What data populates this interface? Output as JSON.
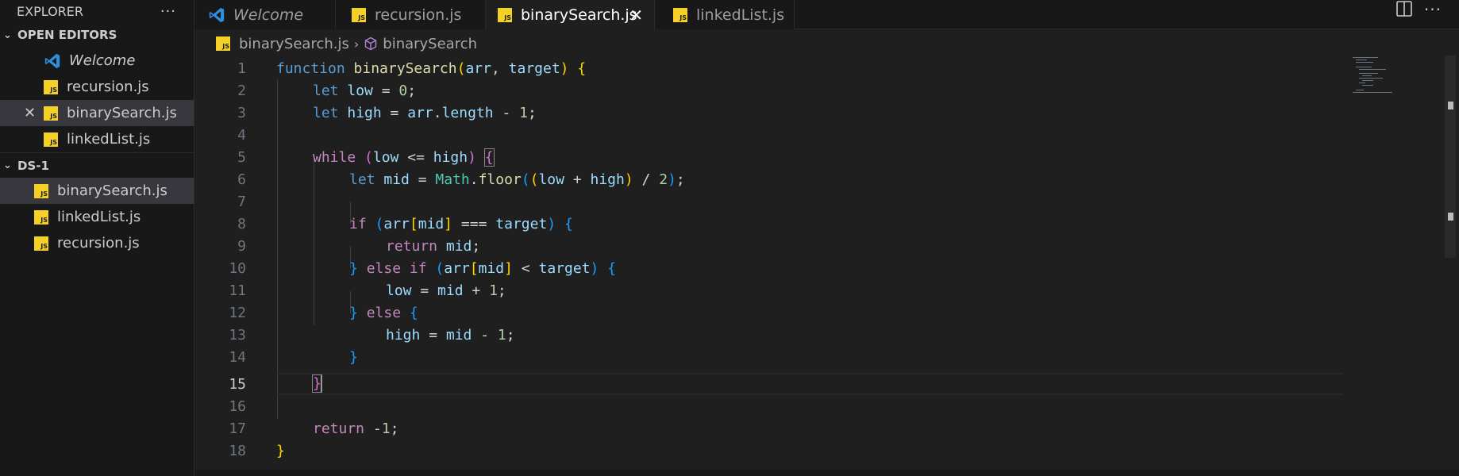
{
  "explorer": {
    "title": "EXPLORER",
    "more": "···",
    "open_editors_label": "OPEN EDITORS",
    "open_editors": [
      {
        "name": "Welcome",
        "type": "vscode"
      },
      {
        "name": "recursion.js",
        "type": "js"
      },
      {
        "name": "binarySearch.js",
        "type": "js",
        "active": true
      },
      {
        "name": "linkedList.js",
        "type": "js"
      }
    ],
    "folder_label": "DS-1",
    "files": [
      {
        "name": "binarySearch.js",
        "active": true
      },
      {
        "name": "linkedList.js"
      },
      {
        "name": "recursion.js"
      }
    ],
    "close_glyph": "✕",
    "chevron": "⌄"
  },
  "tabs": [
    {
      "name": "Welcome",
      "type": "vscode"
    },
    {
      "name": "recursion.js",
      "type": "js"
    },
    {
      "name": "binarySearch.js",
      "type": "js",
      "active": true
    },
    {
      "name": "linkedList.js",
      "type": "js"
    }
  ],
  "tab_close_glyph": "✕",
  "tab_more": "···",
  "js_badge": "JS",
  "breadcrumb": {
    "file": "binarySearch.js",
    "separator": "›",
    "symbol": "binarySearch"
  },
  "editor": {
    "current_line": 15,
    "lines": [
      {
        "n": "1"
      },
      {
        "n": "2"
      },
      {
        "n": "3"
      },
      {
        "n": "4"
      },
      {
        "n": "5"
      },
      {
        "n": "6"
      },
      {
        "n": "7"
      },
      {
        "n": "8"
      },
      {
        "n": "9"
      },
      {
        "n": "10"
      },
      {
        "n": "11"
      },
      {
        "n": "12"
      },
      {
        "n": "13"
      },
      {
        "n": "14"
      },
      {
        "n": "15"
      },
      {
        "n": "16"
      },
      {
        "n": "17"
      },
      {
        "n": "18"
      }
    ],
    "code": {
      "l1": [
        "function",
        "binarySearch",
        "(",
        "arr",
        ", ",
        "target",
        ") ",
        "{"
      ],
      "l2": [
        "let",
        "low",
        " = ",
        "0",
        ";"
      ],
      "l3": [
        "let",
        "high",
        " = ",
        "arr",
        ".",
        "length",
        " - ",
        "1",
        ";"
      ],
      "l5": [
        "while",
        "(",
        "low",
        " <= ",
        "high",
        ") ",
        "{"
      ],
      "l6": [
        "let",
        "mid",
        " = ",
        "Math",
        ".",
        "floor",
        "(",
        "(",
        "low",
        " + ",
        "high",
        ")",
        " / ",
        "2",
        ")",
        ";"
      ],
      "l8": [
        "if",
        "(",
        "arr",
        "[",
        "mid",
        "]",
        " === ",
        "target",
        ") ",
        "{"
      ],
      "l9": [
        "return",
        "mid",
        ";"
      ],
      "l10": [
        "}",
        "else",
        "if",
        "(",
        "arr",
        "[",
        "mid",
        "]",
        " < ",
        "target",
        ") ",
        "{"
      ],
      "l11": [
        "low",
        " = ",
        "mid",
        " + ",
        "1",
        ";"
      ],
      "l12": [
        "}",
        "else",
        "{"
      ],
      "l13": [
        "high",
        " = ",
        "mid",
        " - ",
        "1",
        ";"
      ],
      "l14": [
        "}"
      ],
      "l15": [
        "}"
      ],
      "l17": [
        "return",
        "-",
        "1",
        ";"
      ],
      "l18": [
        "}"
      ]
    }
  }
}
